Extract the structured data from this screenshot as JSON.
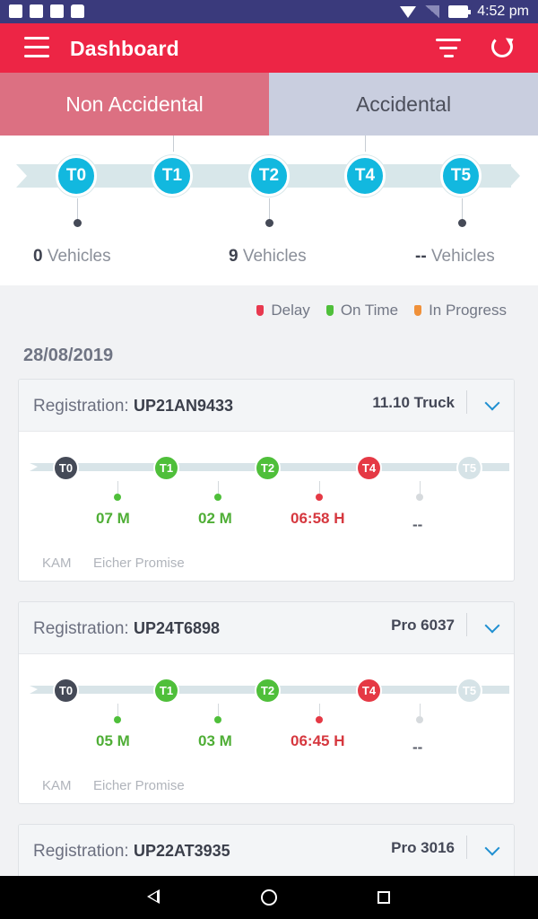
{
  "status_bar": {
    "time": "4:52 pm",
    "icons": [
      "image-icon",
      "alert-icon",
      "mail-icon",
      "lock-icon",
      "wifi-icon",
      "signal-icon",
      "battery-charging-icon"
    ]
  },
  "app_bar": {
    "title": "Dashboard",
    "icons": [
      "menu-icon",
      "filter-icon",
      "refresh-icon"
    ]
  },
  "tabs": [
    {
      "label": "Non Accidental",
      "active": true
    },
    {
      "label": "Accidental",
      "active": false
    }
  ],
  "summary": {
    "nodes": [
      "T0",
      "T1",
      "T2",
      "T4",
      "T5"
    ],
    "counts": [
      {
        "value": "0",
        "label": "Vehicles"
      },
      {
        "value": "9",
        "label": "Vehicles"
      },
      {
        "value": "--",
        "label": "Vehicles"
      }
    ]
  },
  "legend": [
    {
      "label": "Delay",
      "color": "#e8394f"
    },
    {
      "label": "On Time",
      "color": "#4fbf3a"
    },
    {
      "label": "In Progress",
      "color": "#f0913a"
    }
  ],
  "date": "28/08/2019",
  "cards": [
    {
      "registration_label": "Registration:",
      "registration": "UP21AN9433",
      "model": "11.10 Truck",
      "stages": [
        {
          "label": "T0",
          "status": "start"
        },
        {
          "label": "T1",
          "status": "on-time",
          "value": "07 M"
        },
        {
          "label": "T2",
          "status": "on-time",
          "value": "02 M"
        },
        {
          "label": "T4",
          "status": "delay",
          "value": "06:58 H"
        },
        {
          "label": "T5",
          "status": "pending",
          "value": "--"
        }
      ],
      "footer": [
        "KAM",
        "Eicher Promise"
      ]
    },
    {
      "registration_label": "Registration:",
      "registration": "UP24T6898",
      "model": "Pro 6037",
      "stages": [
        {
          "label": "T0",
          "status": "start"
        },
        {
          "label": "T1",
          "status": "on-time",
          "value": "05 M"
        },
        {
          "label": "T2",
          "status": "on-time",
          "value": "03 M"
        },
        {
          "label": "T4",
          "status": "delay",
          "value": "06:45 H"
        },
        {
          "label": "T5",
          "status": "pending",
          "value": "--"
        }
      ],
      "footer": [
        "KAM",
        "Eicher Promise"
      ]
    },
    {
      "registration_label": "Registration:",
      "registration": "UP22AT3935",
      "model": "Pro 3016"
    }
  ],
  "colors": {
    "accent": "#ed2545",
    "node_blue": "#12b8df",
    "on_time": "#4fbf3a",
    "delay": "#e53945",
    "start": "#454a57",
    "pending": "#d6e3e7"
  }
}
